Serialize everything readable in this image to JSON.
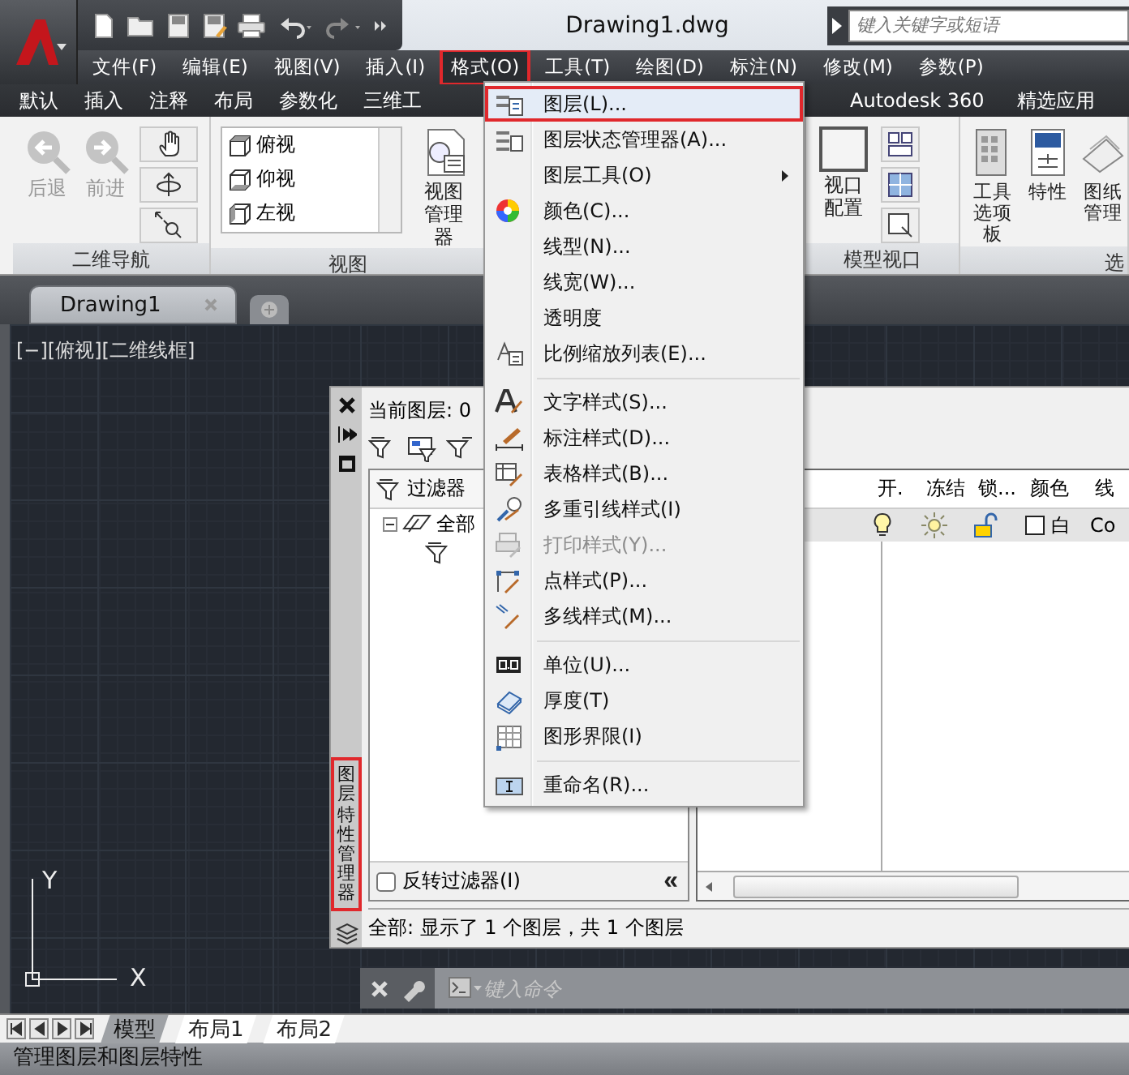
{
  "title_bar": {
    "title": "Drawing1.dwg",
    "search": {
      "placeholder": "键入关键字或短语"
    }
  },
  "menu_bar": [
    {
      "label": "文件(F)",
      "selected": false
    },
    {
      "label": "编辑(E)",
      "selected": false
    },
    {
      "label": "视图(V)",
      "selected": false
    },
    {
      "label": "插入(I)",
      "selected": false
    },
    {
      "label": "格式(O)",
      "selected": true
    },
    {
      "label": "工具(T)",
      "selected": false
    },
    {
      "label": "绘图(D)",
      "selected": false
    },
    {
      "label": "标注(N)",
      "selected": false
    },
    {
      "label": "修改(M)",
      "selected": false
    },
    {
      "label": "参数(P)",
      "selected": false
    }
  ],
  "ribbon_tabs": [
    "默认",
    "插入",
    "注释",
    "布局",
    "参数化",
    "三维工",
    "Autodesk 360",
    "精选应用"
  ],
  "ribbon": {
    "navigation": {
      "title": "二维导航",
      "buttons": [
        {
          "label": "后退",
          "disabled": true
        },
        {
          "label": "前进",
          "disabled": true
        }
      ]
    },
    "view": {
      "title": "视图",
      "views": [
        "俯视",
        "仰视",
        "左视"
      ],
      "manager": [
        "视图",
        "管理器"
      ]
    },
    "viewports": {
      "title": "模型视口",
      "button": [
        "视口",
        "配置"
      ]
    },
    "palettes": {
      "title": "选",
      "buttons": [
        [
          "工具",
          "选项板"
        ],
        [
          "特性"
        ],
        [
          "图纸",
          "管理"
        ]
      ]
    }
  },
  "doc_tabs": [
    {
      "label": "Drawing1",
      "selected": true
    }
  ],
  "viewport": {
    "label": "[−][俯视][二维线框]",
    "ucs": {
      "x": "X",
      "y": "Y"
    }
  },
  "layer_panel": {
    "title": "图层特性管理器",
    "highlighted": true,
    "current_layer": "当前图层: 0",
    "filter_header": "过滤器",
    "tree": {
      "label": "全部",
      "expanded": true
    },
    "columns": [
      "开.",
      "冻结",
      "锁...",
      "颜色",
      "线"
    ],
    "rows": [
      {
        "on": true,
        "frozen": false,
        "locked": false,
        "color": "#ffffff",
        "color_name": "白",
        "linetype": "Co"
      }
    ],
    "invert_filter": {
      "label": "反转过滤器(I)",
      "checked": false
    },
    "collapse": "«",
    "status": "全部: 显示了 1 个图层，共 1 个图层"
  },
  "command_line": {
    "placeholder": "键入命令"
  },
  "format_menu": [
    {
      "kind": "item",
      "label": "图层(L)...",
      "highlighted": true,
      "disabled": false,
      "submenu": false
    },
    {
      "kind": "item",
      "label": "图层状态管理器(A)...",
      "highlighted": false,
      "disabled": false,
      "submenu": false
    },
    {
      "kind": "item",
      "label": "图层工具(O)",
      "highlighted": false,
      "disabled": false,
      "submenu": true
    },
    {
      "kind": "item",
      "label": "颜色(C)...",
      "highlighted": false,
      "disabled": false,
      "submenu": false
    },
    {
      "kind": "item",
      "label": "线型(N)...",
      "highlighted": false,
      "disabled": false,
      "submenu": false
    },
    {
      "kind": "item",
      "label": "线宽(W)...",
      "highlighted": false,
      "disabled": false,
      "submenu": false
    },
    {
      "kind": "item",
      "label": "透明度",
      "highlighted": false,
      "disabled": false,
      "submenu": false
    },
    {
      "kind": "item",
      "label": "比例缩放列表(E)...",
      "highlighted": false,
      "disabled": false,
      "submenu": false
    },
    {
      "kind": "separator"
    },
    {
      "kind": "item",
      "label": "文字样式(S)...",
      "highlighted": false,
      "disabled": false,
      "submenu": false
    },
    {
      "kind": "item",
      "label": "标注样式(D)...",
      "highlighted": false,
      "disabled": false,
      "submenu": false
    },
    {
      "kind": "item",
      "label": "表格样式(B)...",
      "highlighted": false,
      "disabled": false,
      "submenu": false
    },
    {
      "kind": "item",
      "label": "多重引线样式(I)",
      "highlighted": false,
      "disabled": false,
      "submenu": false
    },
    {
      "kind": "item",
      "label": "打印样式(Y)...",
      "highlighted": false,
      "disabled": true,
      "submenu": false
    },
    {
      "kind": "item",
      "label": "点样式(P)...",
      "highlighted": false,
      "disabled": false,
      "submenu": false
    },
    {
      "kind": "item",
      "label": "多线样式(M)...",
      "highlighted": false,
      "disabled": false,
      "submenu": false
    },
    {
      "kind": "separator"
    },
    {
      "kind": "item",
      "label": "单位(U)...",
      "highlighted": false,
      "disabled": false,
      "submenu": false
    },
    {
      "kind": "item",
      "label": "厚度(T)",
      "highlighted": false,
      "disabled": false,
      "submenu": false
    },
    {
      "kind": "item",
      "label": "图形界限(I)",
      "highlighted": false,
      "disabled": false,
      "submenu": false
    },
    {
      "kind": "separator"
    },
    {
      "kind": "item",
      "label": "重命名(R)...",
      "highlighted": false,
      "disabled": false,
      "submenu": false
    }
  ],
  "layout_tabs": [
    {
      "label": "模型",
      "selected": true
    },
    {
      "label": "布局1",
      "selected": false
    },
    {
      "label": "布局2",
      "selected": false
    }
  ],
  "status_bar": "管理图层和图层特性"
}
